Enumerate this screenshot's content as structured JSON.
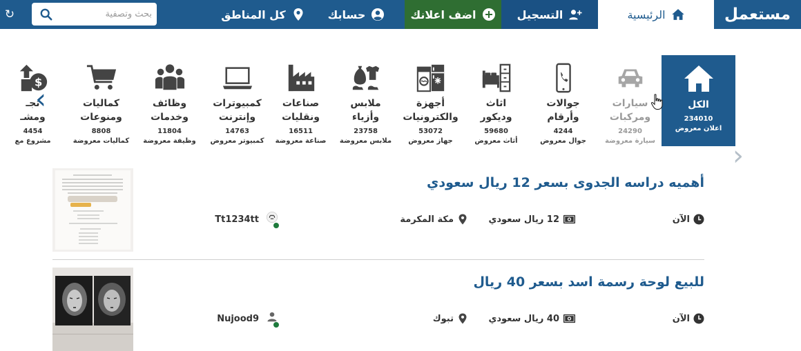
{
  "navbar": {
    "logo": "مستعمل",
    "home_label": "الرئيسية",
    "register_label": "التسجيل",
    "post_ad_label": "اضف اعلانك",
    "account_label": "حسابك",
    "regions_label": "كل المناطق",
    "search_placeholder": "بحث وتصفية"
  },
  "categories": [
    {
      "name": "الكل",
      "count": "234010",
      "sub": "اعلان معروض",
      "icon": "home-icon",
      "active": true
    },
    {
      "name": "سيارات\nومركبات",
      "count": "24290",
      "sub": "سيارة معروضة",
      "icon": "car-icon"
    },
    {
      "name": "جوالات\nوأرقام",
      "count": "4244",
      "sub": "جوال معروض",
      "icon": "phone-icon"
    },
    {
      "name": "اثاث\nوديكور",
      "count": "59680",
      "sub": "أثاث معروض",
      "icon": "furniture-icon"
    },
    {
      "name": "أجهزة\nوالكترونيات",
      "count": "53072",
      "sub": "جهاز معروض",
      "icon": "appliance-icon"
    },
    {
      "name": "ملابس\nوأزياء",
      "count": "23758",
      "sub": "ملابس معروضة",
      "icon": "fashion-icon"
    },
    {
      "name": "صناعات\nونقليات",
      "count": "16511",
      "sub": "صناعة معروضة",
      "icon": "factory-icon"
    },
    {
      "name": "كمبيوترات\nوإنترنت",
      "count": "14763",
      "sub": "كمبيوتر معروض",
      "icon": "laptop-icon"
    },
    {
      "name": "وظائف\nوخدمات",
      "count": "11804",
      "sub": "وظيفة معروضة",
      "icon": "people-icon"
    },
    {
      "name": "كماليات\nومنوعات",
      "count": "8808",
      "sub": "كماليات معروضة",
      "icon": "cart-icon"
    },
    {
      "name": "تجـ\nومشـ",
      "count": "4454",
      "sub": "مشروع مع",
      "icon": "money-icon"
    }
  ],
  "listings": [
    {
      "title": "أهميه دراسه الجدوى بسعر 12 ريال سعودي",
      "time": "الآن",
      "price": "12 ريال سعودي",
      "city": "مكة المكرمة",
      "user": "Tt1234tt"
    },
    {
      "title": "للبيع لوحة رسمة اسد بسعر 40 ريال",
      "time": "الآن",
      "price": "40 ريال سعودي",
      "city": "تبوك",
      "user": "Nujood9"
    }
  ],
  "colors": {
    "brand_blue": "#1f5b8e",
    "post_green": "#2f6e32",
    "register_blue": "#1a5184",
    "online_green": "#1e7a3c"
  }
}
